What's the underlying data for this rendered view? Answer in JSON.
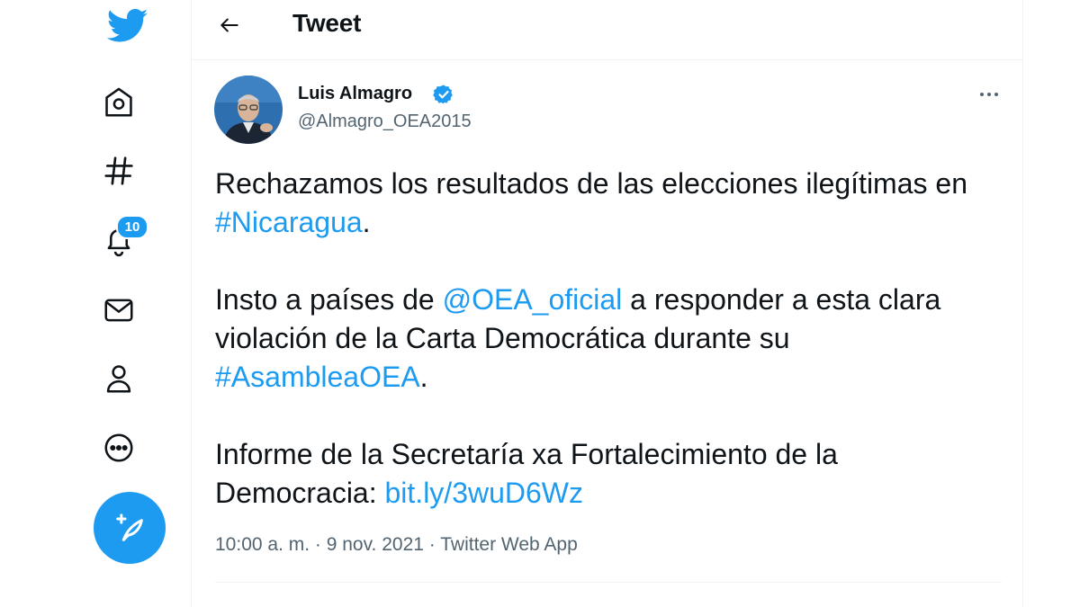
{
  "sidebar": {
    "items": [
      {
        "name": "twitter-logo-icon"
      },
      {
        "name": "home-icon"
      },
      {
        "name": "explore-hashtag-icon"
      },
      {
        "name": "notifications-bell-icon"
      },
      {
        "name": "messages-mail-icon"
      },
      {
        "name": "profile-person-icon"
      },
      {
        "name": "more-circle-icon"
      },
      {
        "name": "compose-feather-icon"
      }
    ],
    "notifications_badge": "10"
  },
  "header": {
    "title": "Tweet",
    "back_icon": "arrow-left-icon"
  },
  "tweet": {
    "author_name": "Luis Almagro",
    "author_handle": "@Almagro_OEA2015",
    "verified": true,
    "more_icon": "ellipsis-icon",
    "paragraph1": {
      "text_a": "Rechazamos los resultados de las elecciones ilegítimas en ",
      "hashtag": "#Nicaragua",
      "text_b": "."
    },
    "paragraph2": {
      "text_a": "Insto a países de ",
      "mention": "@OEA_oficial",
      "text_b": " a responder a esta clara violación de la Carta Democrática durante su ",
      "hashtag": "#AsambleaOEA",
      "text_c": "."
    },
    "paragraph3": {
      "text_a": "Informe de la Secretaría xa Fortalecimiento de la Democracia: ",
      "link": "bit.ly/3wuD6Wz"
    },
    "time": "10:00 a. m.",
    "separator": " · ",
    "date": "9 nov. 2021",
    "source": "Twitter Web App"
  },
  "colors": {
    "accent": "#1d9bf0",
    "text": "#0f1419",
    "secondary": "#536471",
    "border": "#eff3f4"
  }
}
